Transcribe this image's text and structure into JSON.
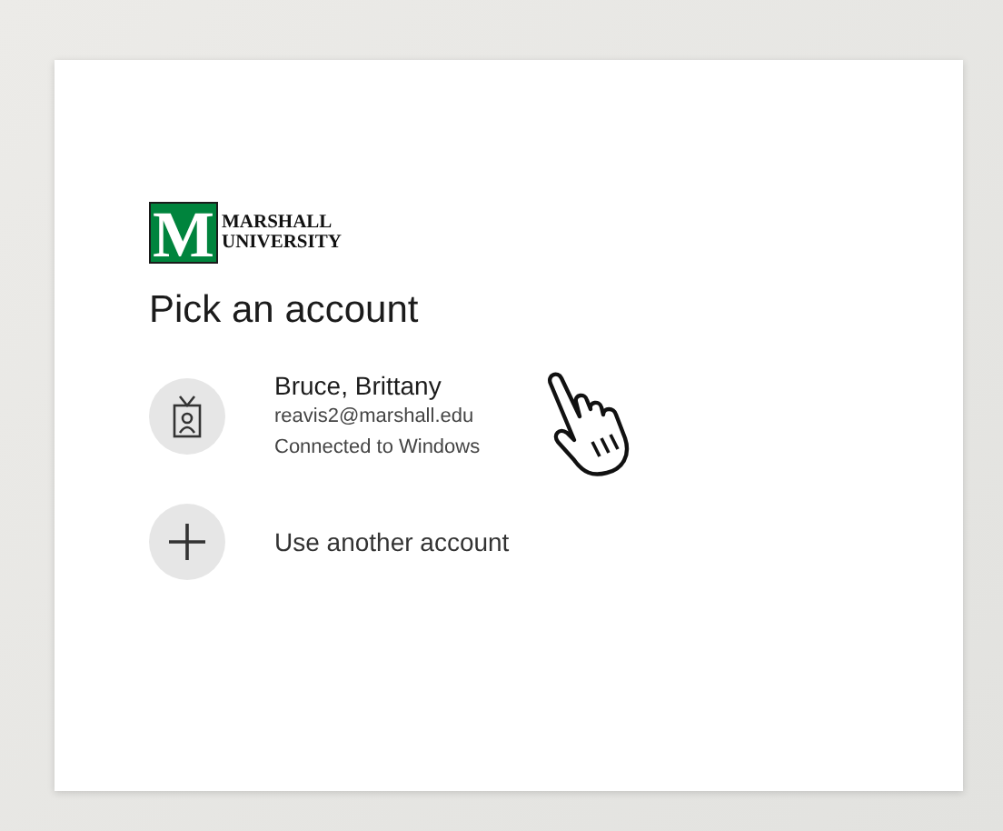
{
  "logo": {
    "mark": "M",
    "lines": [
      "MARSHALL",
      "UNIVERSITY"
    ]
  },
  "heading": "Pick an account",
  "accounts": [
    {
      "kind": "account",
      "name": "Bruce, Brittany",
      "email": "reavis2@marshall.edu",
      "status": "Connected to Windows"
    },
    {
      "kind": "add",
      "label": "Use another account"
    }
  ]
}
